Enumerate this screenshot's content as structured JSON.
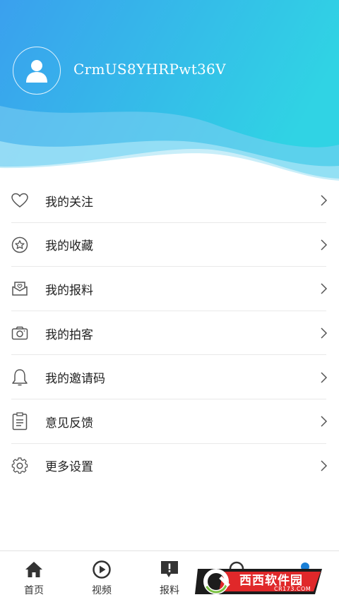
{
  "profile": {
    "username": "CrmUS8YHRPwt36V"
  },
  "menu": [
    {
      "label": "我的关注",
      "icon": "heart-icon"
    },
    {
      "label": "我的收藏",
      "icon": "star-icon"
    },
    {
      "label": "我的报料",
      "icon": "envelope-heart-icon"
    },
    {
      "label": "我的拍客",
      "icon": "camera-icon"
    },
    {
      "label": "我的邀请码",
      "icon": "bell-icon"
    },
    {
      "label": "意见反馈",
      "icon": "clipboard-icon"
    },
    {
      "label": "更多设置",
      "icon": "gear-icon"
    }
  ],
  "tabbar": [
    {
      "label": "首页",
      "icon": "home-icon"
    },
    {
      "label": "视频",
      "icon": "play-icon"
    },
    {
      "label": "报料",
      "icon": "alert-icon"
    },
    {
      "label": "",
      "icon": "search-icon"
    },
    {
      "label": "",
      "icon": "user-icon"
    }
  ],
  "watermark": {
    "text": "西西软件园",
    "sub": "CR173.COM"
  },
  "colors": {
    "header_start": "#3aa3ee",
    "header_end": "#2fd0e6",
    "accent": "#1a7fd6"
  }
}
